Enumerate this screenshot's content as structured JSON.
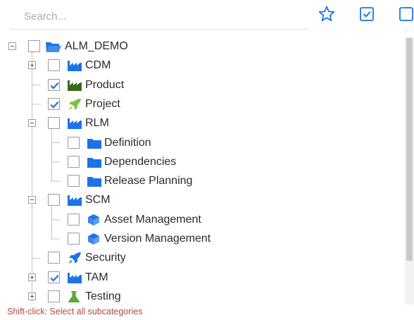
{
  "search": {
    "placeholder": "Search..."
  },
  "toolbar": {
    "favorite_icon": "star-outline-icon",
    "select_all_icon": "checked-box-icon",
    "deselect_all_icon": "empty-box-icon"
  },
  "tree": {
    "root": {
      "label": "ALM_DEMO",
      "icon": "folder-open-icon",
      "checked": false,
      "expanded": true
    },
    "items": [
      {
        "label": "CDM",
        "icon": "factory-icon",
        "checked": false,
        "expander": "plus"
      },
      {
        "label": "Product",
        "icon": "factory-icon",
        "checked": true,
        "expander": "none"
      },
      {
        "label": "Project",
        "icon": "rocket-icon",
        "checked": true,
        "expander": "none"
      },
      {
        "label": "RLM",
        "icon": "factory-icon",
        "checked": false,
        "expander": "minus",
        "children": [
          {
            "label": "Definition",
            "icon": "folder-icon",
            "checked": false
          },
          {
            "label": "Dependencies",
            "icon": "folder-icon",
            "checked": false
          },
          {
            "label": "Release Planning",
            "icon": "folder-icon",
            "checked": false
          }
        ]
      },
      {
        "label": "SCM",
        "icon": "factory-icon",
        "checked": false,
        "expander": "minus",
        "children": [
          {
            "label": "Asset Management",
            "icon": "cube-icon",
            "checked": false
          },
          {
            "label": "Version Management",
            "icon": "cube-icon",
            "checked": false
          }
        ]
      },
      {
        "label": "Security",
        "icon": "rocket-icon",
        "checked": false,
        "expander": "none"
      },
      {
        "label": "TAM",
        "icon": "factory-icon",
        "checked": true,
        "expander": "plus"
      },
      {
        "label": "Testing",
        "icon": "flask-icon",
        "checked": false,
        "expander": "plus"
      }
    ]
  },
  "hint": "Shift-click: Select all subcategories",
  "colors": {
    "accent": "#1a73e8",
    "folder": "#1a73e8",
    "factory_blue": "#1a73e8",
    "factory_green": "#3b6b1a",
    "rocket_green": "#7cc242",
    "rocket_blue": "#1a73e8",
    "flask": "#5aa832",
    "hint": "#b5473f"
  }
}
